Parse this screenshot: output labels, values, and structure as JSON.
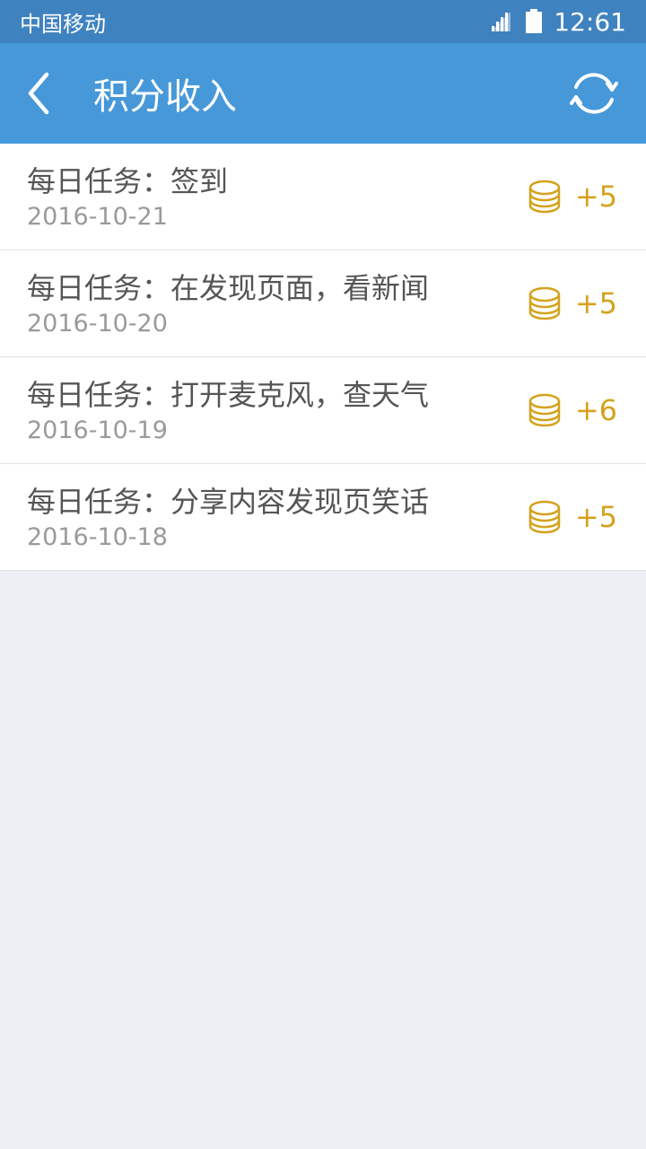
{
  "status_bar": {
    "carrier": "中国移动",
    "time": "12:61",
    "signal_icon": "signal-icon",
    "battery_icon": "battery-icon"
  },
  "app_bar": {
    "title": "积分收入",
    "back_icon": "chevron-left-icon",
    "refresh_icon": "refresh-icon",
    "background_color": "#4698d9"
  },
  "points_color": "#d4a21d",
  "items": [
    {
      "title": "每日任务：签到",
      "date": "2016-10-21",
      "points": "+5"
    },
    {
      "title": "每日任务：在发现页面，看新闻",
      "date": "2016-10-20",
      "points": "+5"
    },
    {
      "title": "每日任务：打开麦克风，查天气",
      "date": "2016-10-19",
      "points": "+6"
    },
    {
      "title": "每日任务：分享内容发现页笑话",
      "date": "2016-10-18",
      "points": "+5"
    }
  ]
}
